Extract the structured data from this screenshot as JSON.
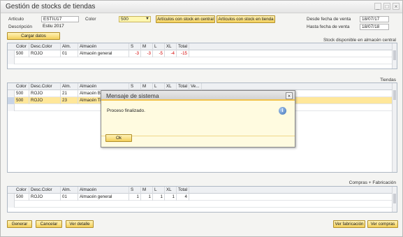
{
  "window": {
    "title": "Gestión de stocks de tiendas",
    "buttons": [
      "_",
      "□",
      "×"
    ]
  },
  "filters": {
    "articulo_label": "Artículo",
    "articulo_value": "ESTIU17",
    "descripcion_label": "Descripción",
    "descripcion_value": "Estiu 2017",
    "color_label": "Color",
    "color_value": "500",
    "btn_stock_central": "Artículos con stock en central",
    "btn_stock_tienda": "Artículos con stock en tienda",
    "desde_label": "Desde fecha de venta",
    "desde_value": "18/07/17",
    "hasta_label": "Hasta fecha de venta",
    "hasta_value": "18/07/18",
    "cargar_datos": "Cargar datos"
  },
  "stock_central": {
    "title": "Stock disponible en almacén central",
    "columns": [
      "Color",
      "Desc.Color",
      "Alm.",
      "Almacén",
      "S",
      "M",
      "L",
      "XL",
      "Total"
    ],
    "rows": [
      [
        "500",
        "ROJO",
        "01",
        "Almacén general",
        "-3",
        "-3",
        "-5",
        "-4",
        "-15"
      ]
    ]
  },
  "tiendas": {
    "title": "Tiendas",
    "columns": [
      "Color",
      "Desc.Color",
      "Alm.",
      "Almacén",
      "S",
      "M",
      "L",
      "XL",
      "Total",
      "Ve..."
    ],
    "rows": [
      [
        "500",
        "ROJO",
        "21",
        "Almacén Bo"
      ],
      [
        "500",
        "ROJO",
        "23",
        "Almacén Tie"
      ]
    ]
  },
  "compras": {
    "title": "Compras + Fabricación",
    "columns": [
      "Color",
      "Desc.Color",
      "Alm.",
      "Almacén",
      "S",
      "M",
      "L",
      "XL",
      "Total"
    ],
    "rows": [
      [
        "500",
        "ROJO",
        "01",
        "Almacén general",
        "1",
        "1",
        "1",
        "1",
        "4"
      ]
    ]
  },
  "footer": {
    "generar": "Generar",
    "cancelar": "Cancelar",
    "ver_detalle": "Ver detalle",
    "ver_fabricacion": "Ver fabricación",
    "ver_compras": "Ver compras"
  },
  "dialog": {
    "title": "Mensaje de sistema",
    "message": "Proceso finalizado.",
    "ok": "Ok",
    "close": "×",
    "info_glyph": "i"
  },
  "colors": {
    "accent": "#f3cf5a",
    "negative": "#d40000",
    "selected_row": "#ffe79a",
    "input_highlight": "#fff7b0"
  }
}
